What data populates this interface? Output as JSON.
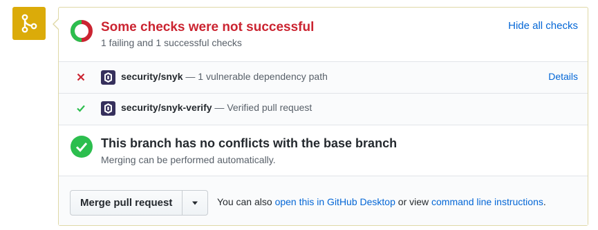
{
  "colors": {
    "merge_badge": "#dbab09",
    "fail": "#cb2431",
    "success": "#2cbe4e",
    "link": "#0366d6",
    "panel_border": "#dfd8a6"
  },
  "status": {
    "title": "Some checks were not successful",
    "subtitle": "1 failing and 1 successful checks",
    "hide_label": "Hide all checks",
    "icon": "partial-status-ring-icon"
  },
  "checks": [
    {
      "state": "failure",
      "icon": "x-icon",
      "name": "security/snyk",
      "separator": " — ",
      "description": "1 vulnerable dependency path",
      "details_label": "Details"
    },
    {
      "state": "success",
      "icon": "check-icon",
      "name": "security/snyk-verify",
      "separator": " — ",
      "description": "Verified pull request"
    }
  ],
  "conflicts": {
    "title": "This branch has no conflicts with the base branch",
    "subtitle": "Merging can be performed automatically."
  },
  "merge": {
    "button_label": "Merge pull request",
    "note_prefix": "You can also ",
    "desktop_link": "open this in GitHub Desktop",
    "note_middle": " or view ",
    "cli_link": "command line instructions",
    "note_suffix": "."
  }
}
